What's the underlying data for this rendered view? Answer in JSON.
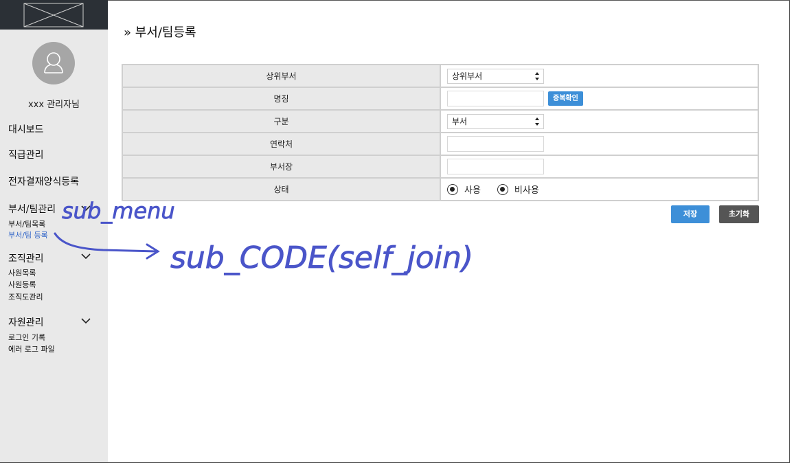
{
  "logo": {
    "icon": "image-placeholder-icon"
  },
  "sidebar": {
    "avatar_icon": "user-icon",
    "admin_name": "xxx 관리자님",
    "menu": {
      "dashboard": "대시보드",
      "position": "직급관리",
      "approval_form": "전자결재양식등록",
      "dept": "부서/팀관리",
      "dept_list": "부서/팀목록",
      "dept_register": "부서/팀 등록",
      "org": "조직관리",
      "emp_list": "사원목록",
      "emp_register": "사원등록",
      "org_chart": "조직도관리",
      "resource": "자원관리",
      "login_log": "로그인 기록",
      "error_log": "에러 로그 파일"
    }
  },
  "page": {
    "title": "» 부서/팀등록"
  },
  "form": {
    "parent_label": "상위부서",
    "parent_value": "상위부서",
    "name_label": "명칭",
    "name_value": "",
    "dup_check": "중복확인",
    "type_label": "구분",
    "type_value": "부서",
    "contact_label": "연락처",
    "contact_value": "",
    "head_label": "부서장",
    "head_value": "",
    "status_label": "상태",
    "status_active": "사용",
    "status_inactive": "비사용"
  },
  "actions": {
    "save": "저장",
    "reset": "초기화"
  },
  "annotations": {
    "sub_menu": "sub_menu",
    "sub_code": "sub_CODE(self_join)"
  },
  "colors": {
    "sidebar_bg": "#e9e9e9",
    "logo_bg": "#2b3036",
    "primary": "#3d8fd8",
    "dark_button": "#555555",
    "annotation_ink": "#4a55c9"
  }
}
